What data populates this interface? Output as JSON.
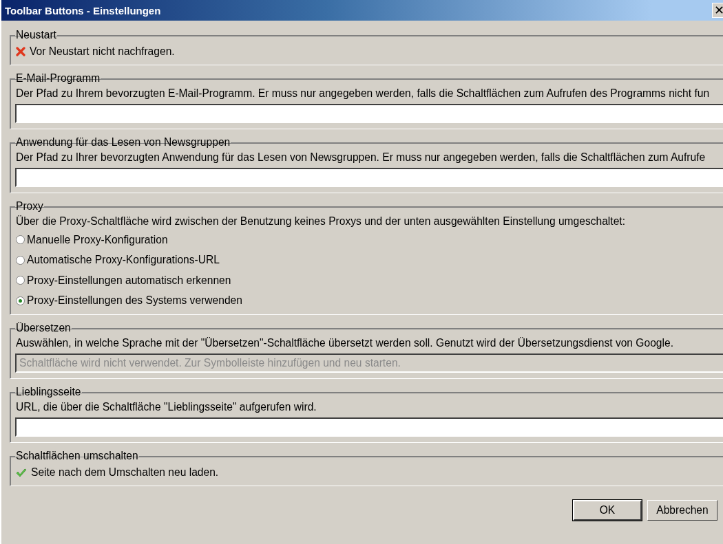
{
  "window": {
    "title": "Toolbar Buttons - Einstellungen",
    "close_glyph": "✕"
  },
  "sections": [
    {
      "kind": "toggle",
      "legend": "Neustart",
      "label": "Vor Neustart nicht nachfragen.",
      "checked": false
    },
    {
      "kind": "path",
      "legend": "E-Mail-Programm",
      "description": "Der Pfad zu Ihrem bevorzugten E-Mail-Programm. Er muss nur angegeben werden, falls die Schaltflächen zum Aufrufen des Programms nicht fun",
      "field": {
        "disabled": false
      }
    },
    {
      "kind": "path",
      "legend": "Anwendung für das Lesen von Newsgruppen",
      "description": "Der Pfad zu Ihrer bevorzugten Anwendung für das Lesen von Newsgruppen. Er muss nur angegeben werden, falls die Schaltflächen zum Aufrufe",
      "field": {
        "disabled": false
      }
    },
    {
      "kind": "radio",
      "legend": "Proxy",
      "description": "Über die Proxy-Schaltfläche wird zwischen der Benutzung keines Proxys und der unten ausgewählten Einstellung umgeschaltet:",
      "options": [
        {
          "label": "Manuelle Proxy-Konfiguration",
          "selected": false
        },
        {
          "label": "Automatische Proxy-Konfigurations-URL",
          "selected": false
        },
        {
          "label": "Proxy-Einstellungen automatisch erkennen",
          "selected": false
        },
        {
          "label": "Proxy-Einstellungen des Systems verwenden",
          "selected": true
        }
      ]
    },
    {
      "kind": "path",
      "legend": "Übersetzen",
      "description": "Auswählen, in welche Sprache mit der \"Übersetzen\"-Schaltfläche übersetzt werden soll. Genutzt wird der Übersetzungsdienst von Google.",
      "field": {
        "value": "Schaltfläche wird nicht verwendet. Zur Symbolleiste hinzufügen und neu starten.",
        "disabled": true
      }
    },
    {
      "kind": "path",
      "legend": "Lieblingsseite",
      "description": "URL, die über die Schaltfläche \"Lieblingsseite\" aufgerufen wird.",
      "field": {
        "disabled": false
      }
    },
    {
      "kind": "toggle",
      "legend": "Schaltflächen umschalten",
      "label": "Seite nach dem Umschalten neu laden.",
      "checked": true
    }
  ],
  "buttons": [
    {
      "label": "OK",
      "default": true
    },
    {
      "label": "Abbrechen",
      "default": false
    }
  ]
}
